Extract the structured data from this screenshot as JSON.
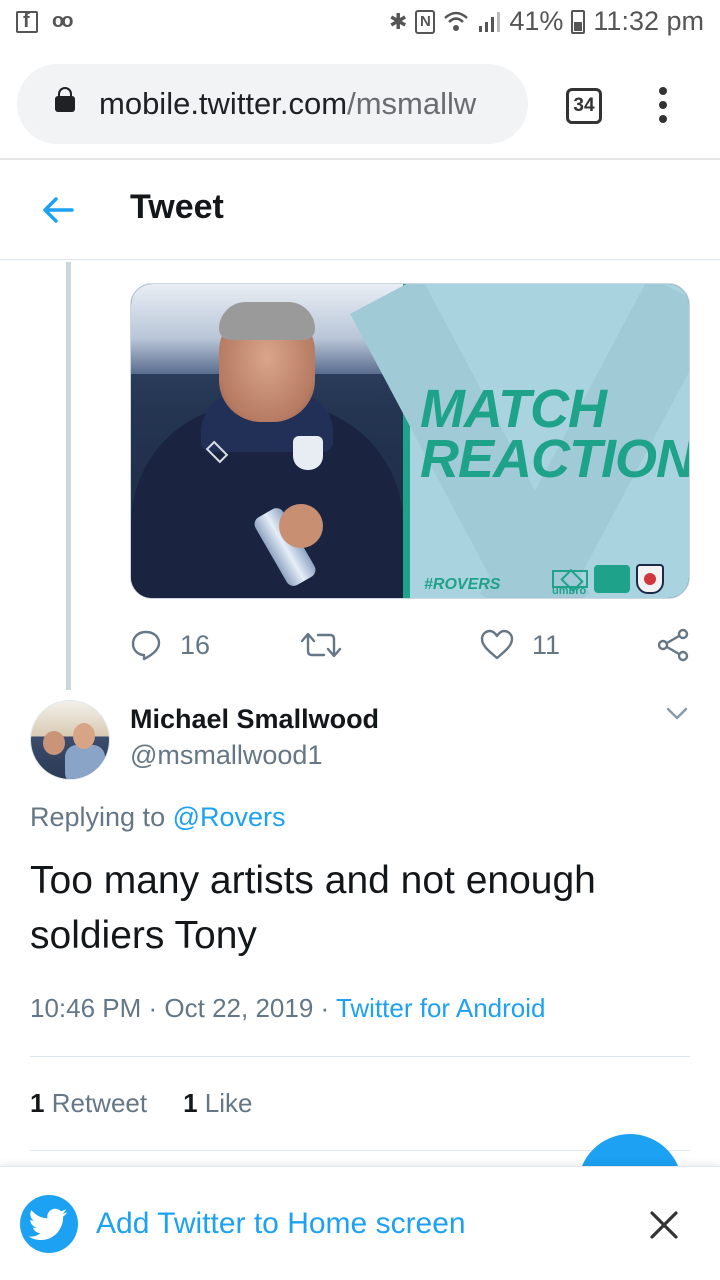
{
  "status_bar": {
    "battery": "41%",
    "time": "11:32 pm"
  },
  "browser": {
    "url_host": "mobile.twitter.com",
    "url_path": "/msmallw",
    "tab_count": "34"
  },
  "header": {
    "title": "Tweet"
  },
  "media": {
    "title_line1": "MATCH",
    "title_line2": "REACTION",
    "hashtag": "#ROVERS",
    "sponsor": "umbro"
  },
  "parent_actions": {
    "replies": "16",
    "likes": "11"
  },
  "reply": {
    "author_name": "Michael Smallwood",
    "author_handle": "@msmallwood1",
    "replying_prefix": "Replying to ",
    "replying_to": "@Rovers",
    "text": "Too many artists and not enough soldiers Tony",
    "time": "10:46 PM",
    "date": "Oct 22, 2019",
    "source": "Twitter for Android",
    "retweet_count": "1",
    "retweet_label": "Retweet",
    "like_count": "1",
    "like_label": "Like"
  },
  "banner": {
    "text": "Add Twitter to Home screen"
  },
  "colors": {
    "twitter_blue": "#1da1f2",
    "secondary_text": "#657786",
    "rovers_teal": "#1fa28a"
  },
  "icons": [
    "facebook-icon",
    "voicemail-icon",
    "bluetooth-icon",
    "nfc-icon",
    "wifi-icon",
    "signal-icon",
    "battery-icon",
    "lock-icon",
    "more-vert-icon",
    "back-arrow-icon",
    "reply-icon",
    "retweet-icon",
    "like-icon",
    "share-icon",
    "chevron-down-icon",
    "twitter-bird-icon",
    "close-icon"
  ]
}
